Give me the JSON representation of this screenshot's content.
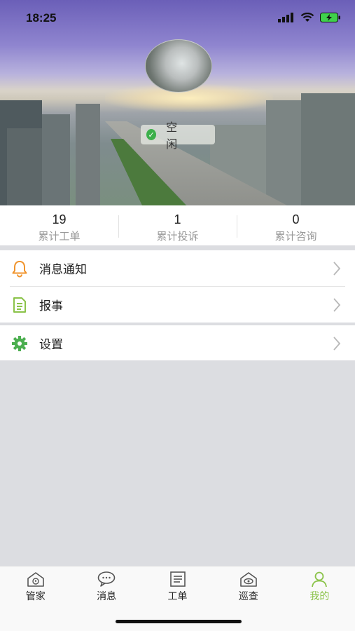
{
  "status_bar": {
    "time": "18:25"
  },
  "profile": {
    "name": "",
    "status": "空 闲"
  },
  "stats": [
    {
      "value": "19",
      "label": "累计工单"
    },
    {
      "value": "1",
      "label": "累计投诉"
    },
    {
      "value": "0",
      "label": "累计咨询"
    }
  ],
  "menu": {
    "notifications": {
      "label": "消息通知",
      "icon": "bell-icon"
    },
    "report": {
      "label": "报事",
      "icon": "document-icon"
    },
    "settings": {
      "label": "设置",
      "icon": "gear-icon"
    }
  },
  "tabs": [
    {
      "label": "管家",
      "icon": "house-icon"
    },
    {
      "label": "消息",
      "icon": "chat-bubble-icon"
    },
    {
      "label": "工单",
      "icon": "list-document-icon"
    },
    {
      "label": "巡查",
      "icon": "house-eye-icon"
    },
    {
      "label": "我的",
      "icon": "person-icon",
      "active": true
    }
  ],
  "colors": {
    "accent": "#8bc34a",
    "status_dot": "#3db04b",
    "bell": "#f0932b",
    "doc": "#8bc34a"
  }
}
